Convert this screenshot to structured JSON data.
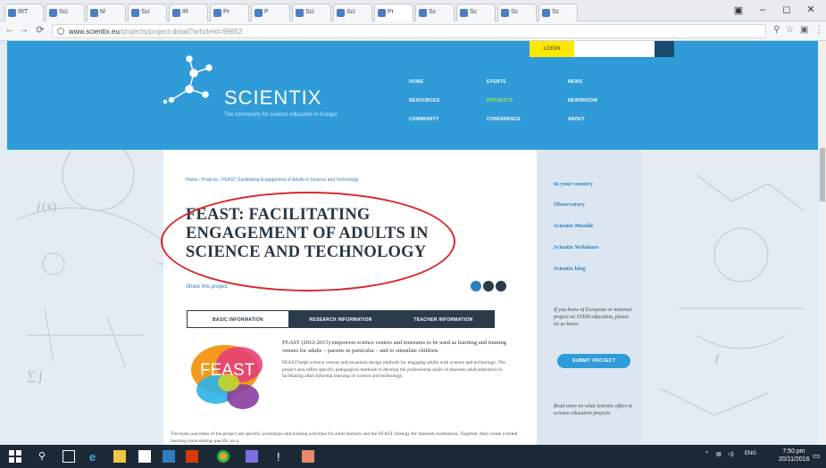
{
  "browser": {
    "tabs": [
      {
        "label": "IRT"
      },
      {
        "label": "Sci"
      },
      {
        "label": "M"
      },
      {
        "label": "Sci"
      },
      {
        "label": "IR"
      },
      {
        "label": "Pr"
      },
      {
        "label": "P"
      },
      {
        "label": "Sci"
      },
      {
        "label": "Sci"
      },
      {
        "label": "Pr"
      },
      {
        "label": "Sc"
      },
      {
        "label": "Sc"
      },
      {
        "label": "Sc"
      },
      {
        "label": "Sc"
      }
    ],
    "url_domain": "www.scientix.eu",
    "url_path": "/projects/project-detail?articleId=99652"
  },
  "site": {
    "brand": "SCIENTIX",
    "tagline": "The community for science education in Europe",
    "login_label": "LOGIN",
    "menu": [
      "HOME",
      "EVENTS",
      "NEWS",
      "RESOURCES",
      "PROJECTS",
      "NEWSROOM",
      "COMMUNITY",
      "CONFERENCE",
      "ABOUT"
    ]
  },
  "article": {
    "breadcrumb": "Home › Projects › FEAST: Facilitating Engagement of Adults in Science and Technology",
    "title_lines": [
      "FEAST: FACILITATING",
      "ENGAGEMENT OF ADULTS IN",
      "SCIENCE AND TECHNOLOGY"
    ],
    "share_label": "Share this project",
    "tabs": [
      "BASIC INFORMATION",
      "RESEARCH INFORMATION",
      "TEACHER INFORMATION"
    ],
    "logo_text": "FEAST",
    "intro_lead": "FEAST (2012-2013) empowers science centres and museums to be used as learning and training venues for adults – parents in particular – and to stimulate children.",
    "intro_body": "FEAST helps science centres and museums design methods for engaging adults with science and technology. The project also offers specific pedagogical methods to develop the professional skills of museum adult educators in facilitating adult informal learning of science and technology.",
    "para2": "The main outcomes of the project are specific workshops and training activities for adult learners and the FEAST strategy for museum institutions. Together, they create a tested learning tools-setting specific on a"
  },
  "sidebar": {
    "links": [
      "In your country",
      "Observatory",
      "Scientix Moodle",
      "Scientix Webinars",
      "Scientix blog"
    ],
    "note": "If you know of European or national project on STEM education, please let us know:",
    "submit_label": "SUBMIT PROJECT",
    "note2": "Read more on what Scientix offers to science education projects"
  },
  "taskbar": {
    "tray_lang": "ENG",
    "time": "7:50 pm",
    "date": "20/11/2016"
  }
}
